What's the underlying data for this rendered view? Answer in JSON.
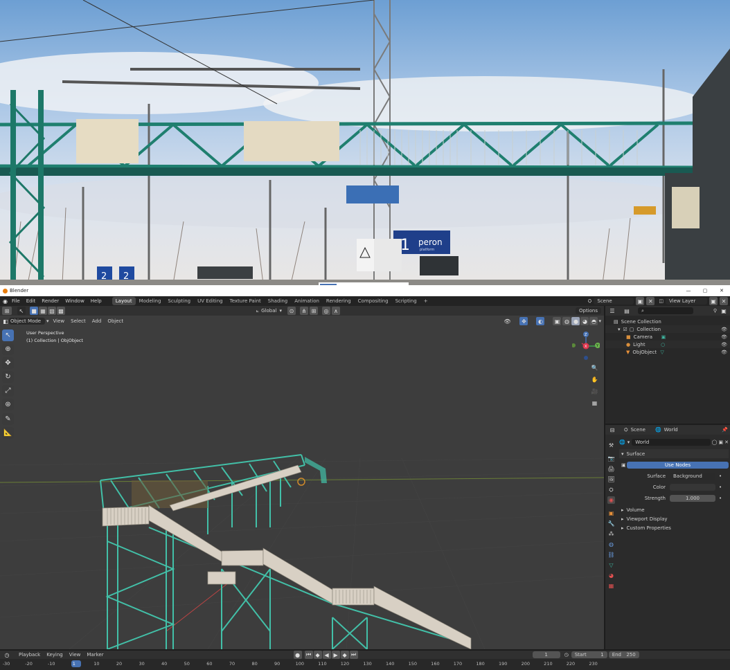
{
  "window": {
    "title": "Blender",
    "min": "—",
    "max": "▢",
    "close": "✕"
  },
  "topbar": {
    "menus": [
      "File",
      "Edit",
      "Render",
      "Window",
      "Help"
    ],
    "workspaces": [
      "Layout",
      "Modeling",
      "Sculpting",
      "UV Editing",
      "Texture Paint",
      "Shading",
      "Animation",
      "Rendering",
      "Compositing",
      "Scripting"
    ],
    "add_tab": "+",
    "scene": "Scene",
    "view_layer": "View Layer"
  },
  "viewport": {
    "mode": "Object Mode",
    "menus": [
      "View",
      "Select",
      "Add",
      "Object"
    ],
    "orientation": "Global",
    "options": "Options",
    "info_line1": "User Perspective",
    "info_line2": "(1) Collection | ObjObject",
    "gizmo": {
      "x": "X",
      "y": "Y",
      "z": "Z"
    }
  },
  "outliner": {
    "root": "Scene Collection",
    "collection": "Collection",
    "items": [
      {
        "name": "Camera",
        "color": "#d98f3c"
      },
      {
        "name": "Light",
        "color": "#d98f3c"
      },
      {
        "name": "ObjObject",
        "color": "#e8913a"
      }
    ]
  },
  "properties": {
    "scene_tab": "Scene",
    "world_tab": "World",
    "world_name": "World",
    "surface_header": "Surface",
    "use_nodes": "Use Nodes",
    "surface_label": "Surface",
    "surface_value": "Background",
    "color_label": "Color",
    "strength_label": "Strength",
    "strength_value": "1.000",
    "collapsed": [
      "Volume",
      "Viewport Display",
      "Custom Properties"
    ]
  },
  "timeline": {
    "menus": [
      "Playback",
      "Keying",
      "View",
      "Marker"
    ],
    "current_frame": "1",
    "start_label": "Start",
    "start_value": "1",
    "end_label": "End",
    "end_value": "250",
    "ticks": [
      "-30",
      "-20",
      "-10",
      "1",
      "10",
      "20",
      "30",
      "40",
      "50",
      "60",
      "70",
      "80",
      "90",
      "100",
      "110",
      "120",
      "130",
      "140",
      "150",
      "160",
      "170",
      "180",
      "190",
      "200",
      "210",
      "220",
      "230"
    ],
    "playhead": "1"
  },
  "photo": {
    "sign_number": "1",
    "sign_word": "peron",
    "sign_sub": "platform",
    "small_signs": [
      "2",
      "2"
    ],
    "warning_text": "!"
  },
  "colors": {
    "accent": "#4772b3",
    "truss": "#3fb5a0",
    "header": "#303030",
    "viewport": "#3d3d3d"
  }
}
